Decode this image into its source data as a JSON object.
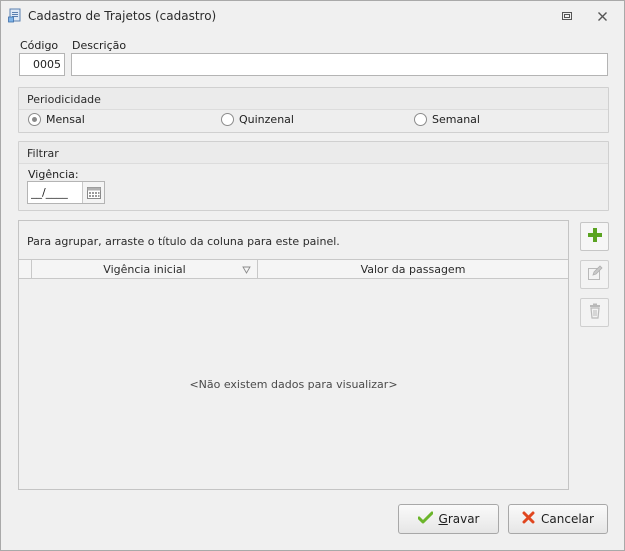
{
  "window": {
    "title": "Cadastro de Trajetos (cadastro)"
  },
  "form": {
    "codigo_label": "Código",
    "codigo_value": "0005",
    "descricao_label": "Descrição",
    "descricao_value": ""
  },
  "periodicidade": {
    "title": "Periodicidade",
    "options": [
      {
        "label": "Mensal",
        "selected": true
      },
      {
        "label": "Quinzenal",
        "selected": false
      },
      {
        "label": "Semanal",
        "selected": false
      }
    ]
  },
  "filtrar": {
    "title": "Filtrar",
    "vigencia_label": "Vigência:",
    "vigencia_value": "__/____"
  },
  "grid": {
    "group_panel_text": "Para agrupar, arraste o título da coluna para este painel.",
    "columns": [
      "Vigência inicial",
      "Valor da passagem"
    ],
    "empty_text": "<Não existem dados para visualizar>"
  },
  "buttons": {
    "gravar_prefix": "",
    "gravar_mnemonic": "G",
    "gravar_rest": "ravar",
    "cancelar": "Cancelar"
  },
  "icons": {
    "app": "document-icon",
    "restore": "restore-icon",
    "close": "close-icon",
    "calendar": "calendar-icon",
    "add": "plus-icon",
    "edit": "edit-icon",
    "delete": "trash-icon",
    "confirm": "checkmark-icon",
    "cancel": "x-icon"
  },
  "colors": {
    "add_green": "#5aa321",
    "confirm_green": "#6bb52a",
    "cancel_red": "#e0461f",
    "disabled_gray": "#b9b9b9"
  }
}
